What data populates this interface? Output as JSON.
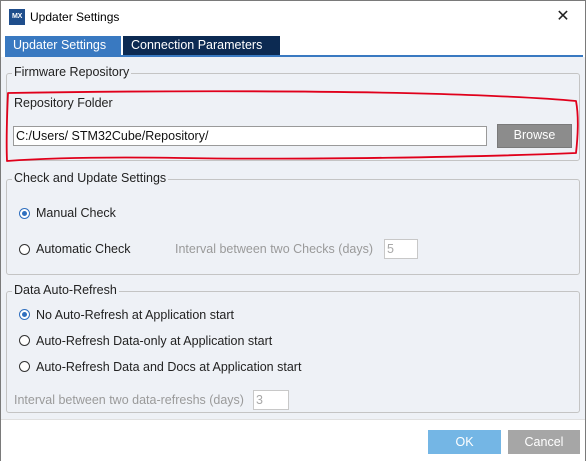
{
  "window": {
    "title": "Updater Settings",
    "app_icon_text": "MX",
    "close_glyph": "✕"
  },
  "tabs": [
    {
      "label": "Updater Settings",
      "active": true
    },
    {
      "label": "Connection Parameters",
      "active": false
    }
  ],
  "firmware_repository": {
    "group_title": "Firmware Repository",
    "folder_label": "Repository Folder",
    "folder_value": "C:/Users/              STM32Cube/Repository/",
    "browse_label": "Browse"
  },
  "check_update": {
    "group_title": "Check and Update Settings",
    "manual_label": "Manual Check",
    "manual_checked": true,
    "automatic_label": "Automatic Check",
    "automatic_checked": false,
    "interval_label": "Interval between two Checks (days)",
    "interval_value": "5"
  },
  "auto_refresh": {
    "group_title": "Data Auto-Refresh",
    "options": [
      {
        "label": "No Auto-Refresh at Application start",
        "checked": true
      },
      {
        "label": "Auto-Refresh Data-only at Application start",
        "checked": false
      },
      {
        "label": "Auto-Refresh Data and Docs at Application start",
        "checked": false
      }
    ],
    "interval_label": "Interval between two data-refreshs (days)",
    "interval_value": "3"
  },
  "footer": {
    "ok_label": "OK",
    "cancel_label": "Cancel"
  },
  "colors": {
    "tab_active": "#3979c1",
    "tab_inactive": "#0c2a52",
    "highlight_annotation": "#e0001b",
    "ok_button": "#74b6e5",
    "cancel_button": "#a6a6a6"
  }
}
